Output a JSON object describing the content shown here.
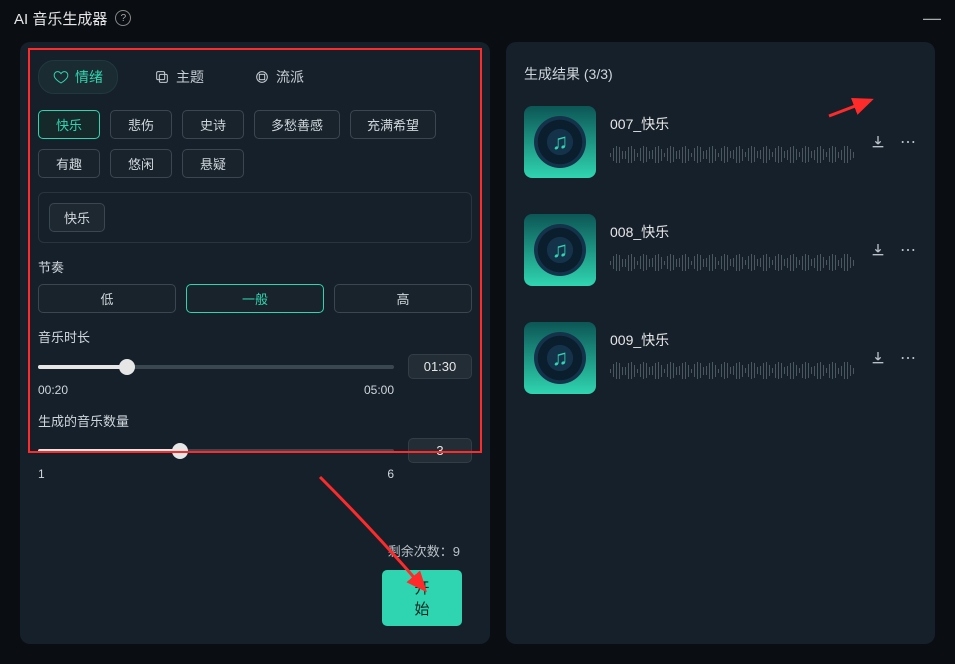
{
  "title": "AI 音乐生成器",
  "tabs": {
    "emotion": "情绪",
    "theme": "主题",
    "genre": "流派"
  },
  "emotion_tags": [
    "快乐",
    "悲伤",
    "史诗",
    "多愁善感",
    "充满希望",
    "有趣",
    "悠闲",
    "悬疑"
  ],
  "active_tag": "快乐",
  "selected_tag": "快乐",
  "sections": {
    "tempo": "节奏",
    "duration": "音乐时长",
    "count": "生成的音乐数量"
  },
  "tempo": {
    "options": [
      "低",
      "一般",
      "高"
    ],
    "active": "一般"
  },
  "duration": {
    "min": "00:20",
    "max": "05:00",
    "value": "01:30",
    "percent": 25
  },
  "count": {
    "min": "1",
    "max": "6",
    "value": "3",
    "percent": 40
  },
  "remaining": {
    "label": "剩余次数：",
    "value": "9"
  },
  "start": "开始",
  "results": {
    "title_prefix": "生成结果",
    "count_text": "(3/3)",
    "items": [
      {
        "name": "007_快乐"
      },
      {
        "name": "008_快乐"
      },
      {
        "name": "009_快乐"
      }
    ]
  }
}
